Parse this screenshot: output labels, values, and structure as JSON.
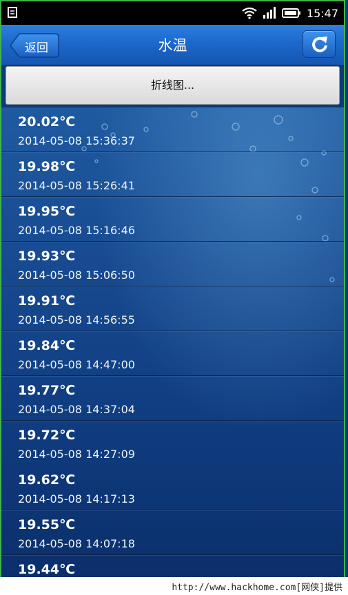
{
  "status_bar": {
    "time": "15:47"
  },
  "header": {
    "back_label": "返回",
    "title": "水温"
  },
  "chart_button": {
    "label": "折线图..."
  },
  "records": [
    {
      "temp": "20.02℃",
      "time": "2014-05-08 15:36:37"
    },
    {
      "temp": "19.98℃",
      "time": "2014-05-08 15:26:41"
    },
    {
      "temp": "19.95℃",
      "time": "2014-05-08 15:16:46"
    },
    {
      "temp": "19.93℃",
      "time": "2014-05-08 15:06:50"
    },
    {
      "temp": "19.91℃",
      "time": "2014-05-08 14:56:55"
    },
    {
      "temp": "19.84℃",
      "time": "2014-05-08 14:47:00"
    },
    {
      "temp": "19.77℃",
      "time": "2014-05-08 14:37:04"
    },
    {
      "temp": "19.72℃",
      "time": "2014-05-08 14:27:09"
    },
    {
      "temp": "19.62℃",
      "time": "2014-05-08 14:17:13"
    },
    {
      "temp": "19.55℃",
      "time": "2014-05-08 14:07:18"
    },
    {
      "temp": "19.44℃",
      "time": ""
    }
  ],
  "watermark": "http://www.hackhome.com[网侠]提供"
}
